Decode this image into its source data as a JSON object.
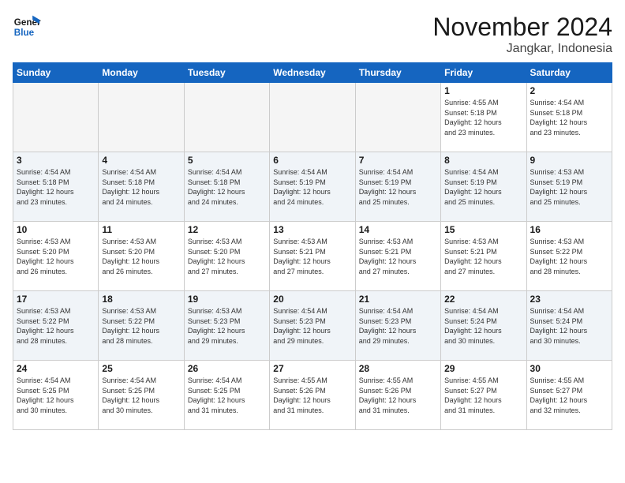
{
  "header": {
    "logo_line1": "General",
    "logo_line2": "Blue",
    "month_title": "November 2024",
    "location": "Jangkar, Indonesia"
  },
  "days_of_week": [
    "Sunday",
    "Monday",
    "Tuesday",
    "Wednesday",
    "Thursday",
    "Friday",
    "Saturday"
  ],
  "weeks": [
    [
      {
        "day": "",
        "info": ""
      },
      {
        "day": "",
        "info": ""
      },
      {
        "day": "",
        "info": ""
      },
      {
        "day": "",
        "info": ""
      },
      {
        "day": "",
        "info": ""
      },
      {
        "day": "1",
        "info": "Sunrise: 4:55 AM\nSunset: 5:18 PM\nDaylight: 12 hours\nand 23 minutes."
      },
      {
        "day": "2",
        "info": "Sunrise: 4:54 AM\nSunset: 5:18 PM\nDaylight: 12 hours\nand 23 minutes."
      }
    ],
    [
      {
        "day": "3",
        "info": "Sunrise: 4:54 AM\nSunset: 5:18 PM\nDaylight: 12 hours\nand 23 minutes."
      },
      {
        "day": "4",
        "info": "Sunrise: 4:54 AM\nSunset: 5:18 PM\nDaylight: 12 hours\nand 24 minutes."
      },
      {
        "day": "5",
        "info": "Sunrise: 4:54 AM\nSunset: 5:18 PM\nDaylight: 12 hours\nand 24 minutes."
      },
      {
        "day": "6",
        "info": "Sunrise: 4:54 AM\nSunset: 5:19 PM\nDaylight: 12 hours\nand 24 minutes."
      },
      {
        "day": "7",
        "info": "Sunrise: 4:54 AM\nSunset: 5:19 PM\nDaylight: 12 hours\nand 25 minutes."
      },
      {
        "day": "8",
        "info": "Sunrise: 4:54 AM\nSunset: 5:19 PM\nDaylight: 12 hours\nand 25 minutes."
      },
      {
        "day": "9",
        "info": "Sunrise: 4:53 AM\nSunset: 5:19 PM\nDaylight: 12 hours\nand 25 minutes."
      }
    ],
    [
      {
        "day": "10",
        "info": "Sunrise: 4:53 AM\nSunset: 5:20 PM\nDaylight: 12 hours\nand 26 minutes."
      },
      {
        "day": "11",
        "info": "Sunrise: 4:53 AM\nSunset: 5:20 PM\nDaylight: 12 hours\nand 26 minutes."
      },
      {
        "day": "12",
        "info": "Sunrise: 4:53 AM\nSunset: 5:20 PM\nDaylight: 12 hours\nand 27 minutes."
      },
      {
        "day": "13",
        "info": "Sunrise: 4:53 AM\nSunset: 5:21 PM\nDaylight: 12 hours\nand 27 minutes."
      },
      {
        "day": "14",
        "info": "Sunrise: 4:53 AM\nSunset: 5:21 PM\nDaylight: 12 hours\nand 27 minutes."
      },
      {
        "day": "15",
        "info": "Sunrise: 4:53 AM\nSunset: 5:21 PM\nDaylight: 12 hours\nand 27 minutes."
      },
      {
        "day": "16",
        "info": "Sunrise: 4:53 AM\nSunset: 5:22 PM\nDaylight: 12 hours\nand 28 minutes."
      }
    ],
    [
      {
        "day": "17",
        "info": "Sunrise: 4:53 AM\nSunset: 5:22 PM\nDaylight: 12 hours\nand 28 minutes."
      },
      {
        "day": "18",
        "info": "Sunrise: 4:53 AM\nSunset: 5:22 PM\nDaylight: 12 hours\nand 28 minutes."
      },
      {
        "day": "19",
        "info": "Sunrise: 4:53 AM\nSunset: 5:23 PM\nDaylight: 12 hours\nand 29 minutes."
      },
      {
        "day": "20",
        "info": "Sunrise: 4:54 AM\nSunset: 5:23 PM\nDaylight: 12 hours\nand 29 minutes."
      },
      {
        "day": "21",
        "info": "Sunrise: 4:54 AM\nSunset: 5:23 PM\nDaylight: 12 hours\nand 29 minutes."
      },
      {
        "day": "22",
        "info": "Sunrise: 4:54 AM\nSunset: 5:24 PM\nDaylight: 12 hours\nand 30 minutes."
      },
      {
        "day": "23",
        "info": "Sunrise: 4:54 AM\nSunset: 5:24 PM\nDaylight: 12 hours\nand 30 minutes."
      }
    ],
    [
      {
        "day": "24",
        "info": "Sunrise: 4:54 AM\nSunset: 5:25 PM\nDaylight: 12 hours\nand 30 minutes."
      },
      {
        "day": "25",
        "info": "Sunrise: 4:54 AM\nSunset: 5:25 PM\nDaylight: 12 hours\nand 30 minutes."
      },
      {
        "day": "26",
        "info": "Sunrise: 4:54 AM\nSunset: 5:25 PM\nDaylight: 12 hours\nand 31 minutes."
      },
      {
        "day": "27",
        "info": "Sunrise: 4:55 AM\nSunset: 5:26 PM\nDaylight: 12 hours\nand 31 minutes."
      },
      {
        "day": "28",
        "info": "Sunrise: 4:55 AM\nSunset: 5:26 PM\nDaylight: 12 hours\nand 31 minutes."
      },
      {
        "day": "29",
        "info": "Sunrise: 4:55 AM\nSunset: 5:27 PM\nDaylight: 12 hours\nand 31 minutes."
      },
      {
        "day": "30",
        "info": "Sunrise: 4:55 AM\nSunset: 5:27 PM\nDaylight: 12 hours\nand 32 minutes."
      }
    ]
  ]
}
